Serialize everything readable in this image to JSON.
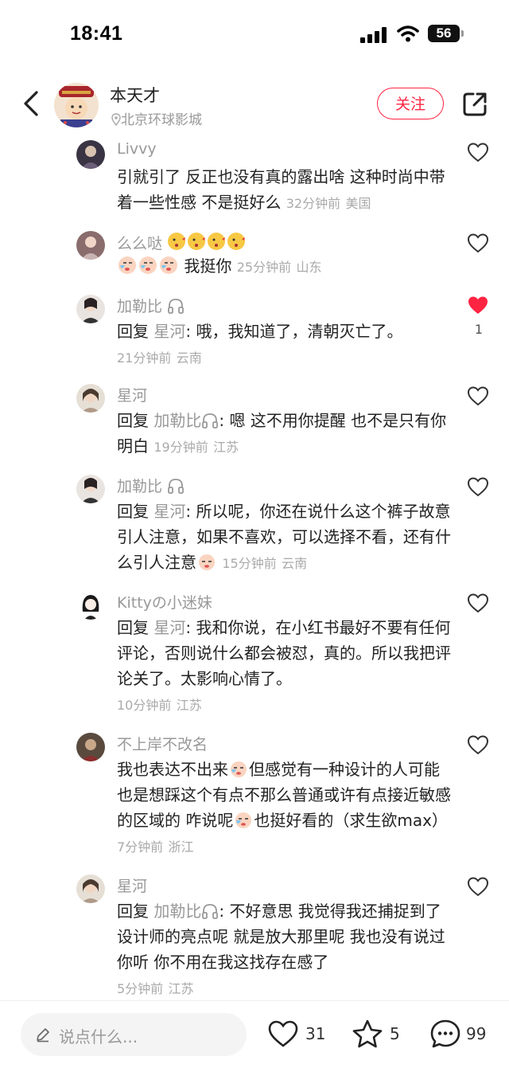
{
  "status_bar": {
    "time": "18:41",
    "battery": "56"
  },
  "header": {
    "author_name": "本天才",
    "location": "北京环球影城",
    "follow_label": "关注"
  },
  "comments": [
    {
      "name": "Livvy",
      "text": "引就引了 反正也没有真的露出啥 这种时尚中带着一些性感 不是挺好么",
      "time": "32分钟前",
      "region": "美国"
    },
    {
      "name": "么么哒",
      "text": "我挺你",
      "time": "25分钟前",
      "region": "山东"
    },
    {
      "name": "加勒比",
      "reply_prefix": "回复",
      "reply_to": "星河",
      "text": ": 哦，我知道了，清朝灭亡了。",
      "time": "21分钟前",
      "region": "云南",
      "likes": "1"
    },
    {
      "name": "星河",
      "reply_prefix": "回复",
      "reply_to": "加勒比",
      "text": ": 嗯 这不用你提醒 也不是只有你明白",
      "time": "19分钟前",
      "region": "江苏"
    },
    {
      "name": "加勒比",
      "reply_prefix": "回复",
      "reply_to": "星河",
      "text": ": 所以呢，你还在说什么这个裤子故意引人注意，如果不喜欢，可以选择不看，还有什么引人注意",
      "time": "15分钟前",
      "region": "云南"
    },
    {
      "name": "Kittyの小迷妹",
      "reply_prefix": "回复",
      "reply_to": "星河",
      "text": ": 我和你说，在小红书最好不要有任何评论，否则说什么都会被怼，真的。所以我把评论关了。太影响心情了。",
      "time": "10分钟前",
      "region": "江苏"
    },
    {
      "name": "不上岸不改名",
      "text_part1": "我也表达不出来",
      "text_part2": "但感觉有一种设计的人可能也是想踩这个有点不那么普通或许有点接近敏感的区域的 咋说呢",
      "text_part3": "也挺好看的（求生欲max）",
      "time": "7分钟前",
      "region": "浙江"
    },
    {
      "name": "星河",
      "reply_prefix": "回复",
      "reply_to": "加勒比",
      "text": ": 不好意思 我觉得我还捕捉到了设计师的亮点呢 就是放大那里呢  我也没有说过你听 你不用在我这找存在感了",
      "time": "5分钟前",
      "region": "江苏"
    }
  ],
  "bottom_bar": {
    "input_placeholder": "说点什么...",
    "likes": "31",
    "favorites": "5",
    "comments": "99"
  },
  "colors": {
    "accent": "#ff2442",
    "muted": "#999999",
    "like_active": "#ff2442"
  }
}
